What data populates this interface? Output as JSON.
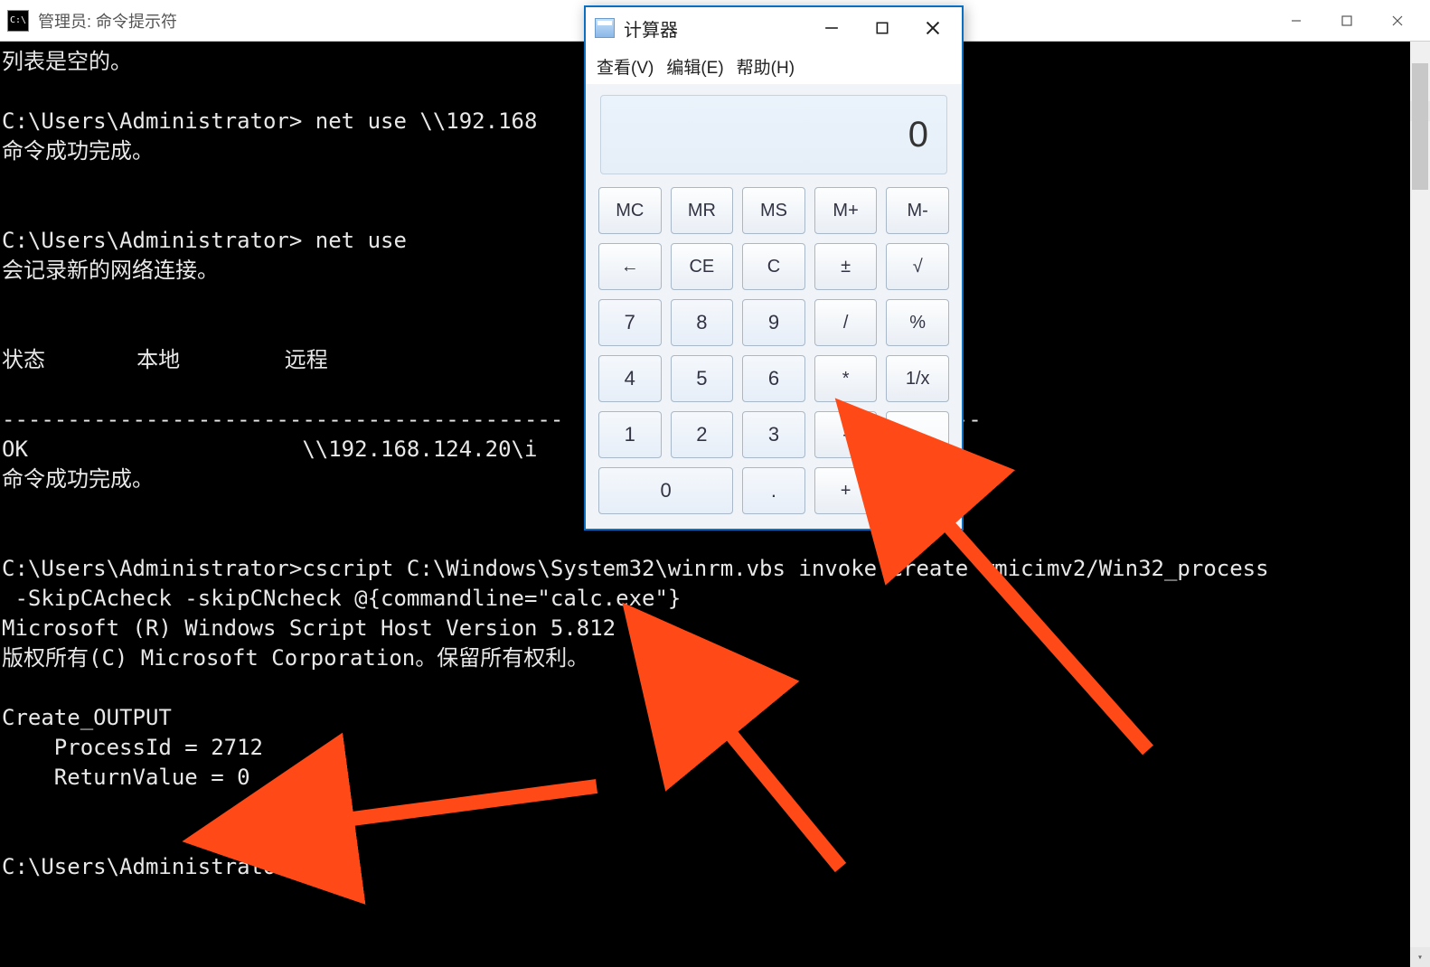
{
  "cmd": {
    "title": "管理员: 命令提示符",
    "lines": [
      "列表是空的。",
      "",
      "C:\\Users\\Administrator> net use \\\\192.168                     er:\"admin\"",
      "命令成功完成。",
      "",
      "",
      "C:\\Users\\Administrator> net use",
      "会记录新的网络连接。",
      "",
      "",
      "状态       本地        远程",
      "",
      "-------------------------------------------                     -----------",
      "OK                     \\\\192.168.124.20\\i                      Network",
      "命令成功完成。",
      "",
      "",
      "C:\\Users\\Administrator>cscript C:\\Windows\\System32\\winrm.vbs invoke Create wmicimv2/Win32_process",
      " -SkipCAcheck -skipCNcheck @{commandline=\"calc.exe\"}",
      "Microsoft (R) Windows Script Host Version 5.812",
      "版权所有(C) Microsoft Corporation。保留所有权利。",
      "",
      "Create_OUTPUT",
      "    ProcessId = 2712",
      "    ReturnValue = 0",
      "",
      "",
      "C:\\Users\\Administrator>"
    ]
  },
  "calc": {
    "title": "计算器",
    "menu": {
      "view": "查看(V)",
      "edit": "编辑(E)",
      "help": "帮助(H)"
    },
    "display": "0",
    "buttons": {
      "mc": "MC",
      "mr": "MR",
      "ms": "MS",
      "mplus": "M+",
      "mminus": "M-",
      "back": "←",
      "ce": "CE",
      "c": "C",
      "pm": "±",
      "sqrt": "√",
      "n7": "7",
      "n8": "8",
      "n9": "9",
      "div": "/",
      "pct": "%",
      "n4": "4",
      "n5": "5",
      "n6": "6",
      "mul": "*",
      "recip": "1/x",
      "n1": "1",
      "n2": "2",
      "n3": "3",
      "sub": "-",
      "eq": "=",
      "n0": "0",
      "dot": ".",
      "add": "+"
    }
  }
}
